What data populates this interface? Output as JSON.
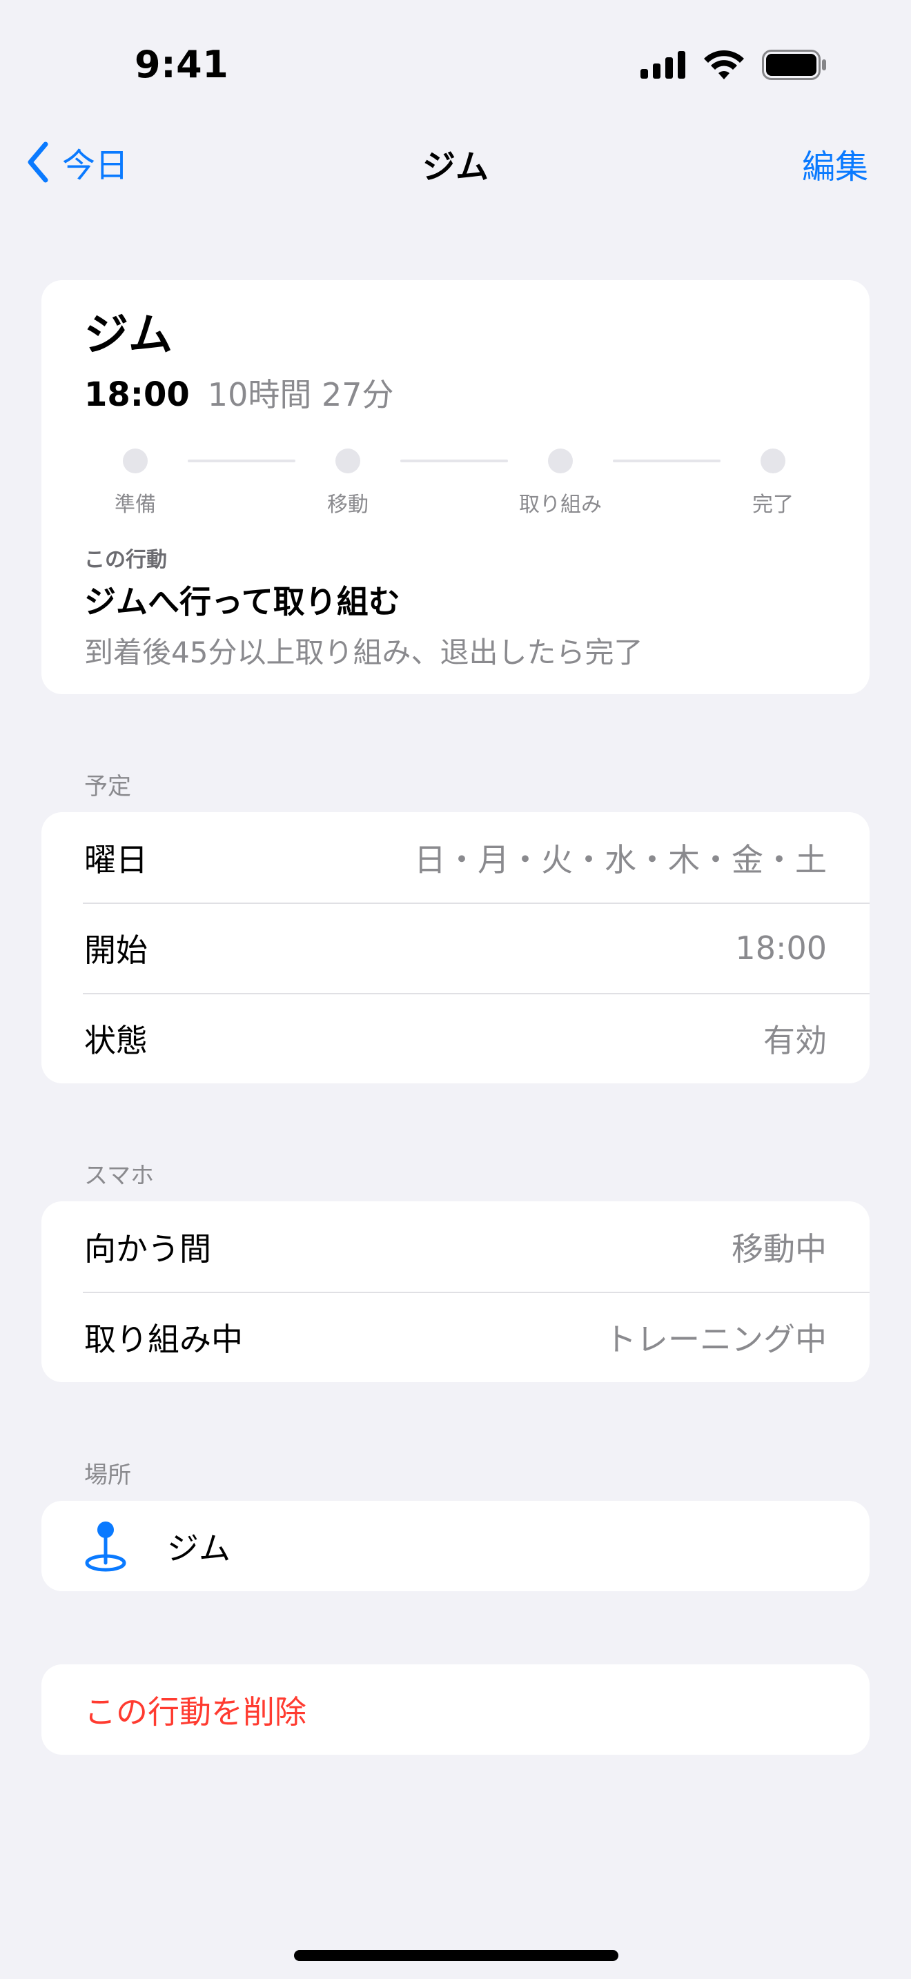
{
  "status_bar": {
    "time": "9:41"
  },
  "nav": {
    "back_label": "今日",
    "title": "ジム",
    "edit_label": "編集"
  },
  "summary": {
    "name": "ジム",
    "start_time": "18:00",
    "remaining": "10時間 27分",
    "steps": [
      {
        "label": "準備"
      },
      {
        "label": "移動"
      },
      {
        "label": "取り組み"
      },
      {
        "label": "完了"
      }
    ],
    "action_caption": "この行動",
    "action_title": "ジムへ行って取り組む",
    "action_description": "到着後45分以上取り組み、退出したら完了"
  },
  "schedule": {
    "header": "予定",
    "rows": [
      {
        "label": "曜日",
        "value": "日・月・火・水・木・金・土"
      },
      {
        "label": "開始",
        "value": "18:00"
      },
      {
        "label": "状態",
        "value": "有効"
      }
    ]
  },
  "phone": {
    "header": "スマホ",
    "rows": [
      {
        "label": "向かう間",
        "value": "移動中"
      },
      {
        "label": "取り組み中",
        "value": "トレーニング中"
      }
    ]
  },
  "location": {
    "header": "場所",
    "name": "ジム",
    "icon": "location-pin-icon"
  },
  "delete": {
    "label": "この行動を削除"
  },
  "colors": {
    "accent": "#0a7aff",
    "destructive": "#ff3b30",
    "background": "#f2f2f7",
    "secondary_text": "#8a8a8e"
  }
}
